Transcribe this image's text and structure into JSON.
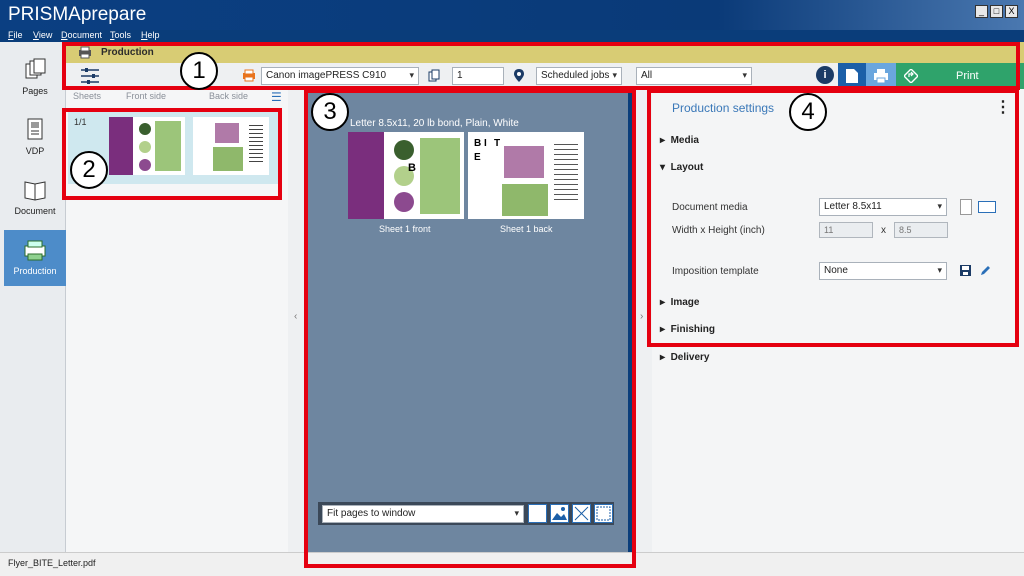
{
  "app": {
    "title": "PRISMAprepare"
  },
  "window_buttons": [
    "_",
    "□",
    "X"
  ],
  "menu": [
    "File",
    "View",
    "Document",
    "Tools",
    "Help"
  ],
  "nav": [
    {
      "label": "Pages",
      "icon": "pages-icon"
    },
    {
      "label": "VDP",
      "icon": "vdp-icon"
    },
    {
      "label": "Document",
      "icon": "document-icon"
    },
    {
      "label": "Production",
      "icon": "production-icon",
      "active": true
    }
  ],
  "production_bar": {
    "label": "Production"
  },
  "toolbar": {
    "printer": "Canon imagePRESS C910",
    "copies": "1",
    "destination": "Scheduled jobs",
    "filter": "All",
    "print_label": "Print"
  },
  "sheets_panel": {
    "headers": [
      "Sheets",
      "Front side",
      "Back side"
    ],
    "rows": [
      {
        "index": "1/1"
      }
    ]
  },
  "preview": {
    "media_label": "Letter 8.5x11, 20 lb bond, Plain, White",
    "front_caption": "Sheet 1 front",
    "back_caption": "Sheet 1 back",
    "zoom": "Fit pages to window"
  },
  "settings": {
    "title": "Production settings",
    "sections": [
      "Media",
      "Layout",
      "Image",
      "Finishing",
      "Delivery"
    ],
    "document_media_label": "Document media",
    "document_media_value": "Letter 8.5x11",
    "size_label": "Width  x  Height (inch)",
    "width": "11",
    "height": "8.5",
    "x": "x",
    "imposition_label": "Imposition template",
    "imposition_value": "None"
  },
  "status": {
    "filename": "Flyer_BITE_Letter.pdf"
  },
  "callouts": [
    "1",
    "2",
    "3",
    "4"
  ],
  "thumb_text": {
    "b": "B",
    "i": "I",
    "t": "T",
    "e": "E"
  },
  "colors": {
    "accent": "#3a78b8",
    "print": "#2fa36b",
    "highlight": "#e50010",
    "prodbar": "#d8cc74"
  }
}
